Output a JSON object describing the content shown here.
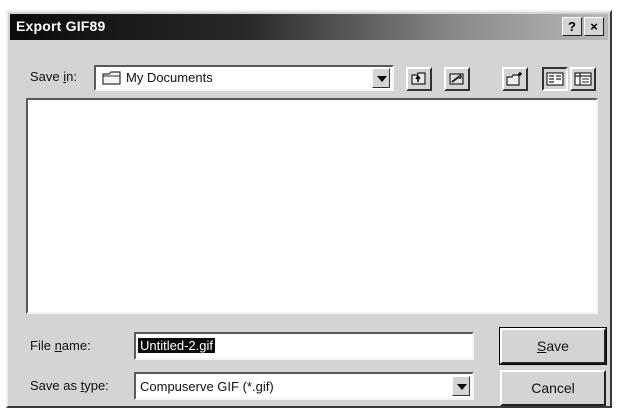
{
  "window": {
    "title": "Export GIF89",
    "help_label": "?",
    "close_label": "×"
  },
  "save_in": {
    "label_pre": "Save ",
    "label_u": "i",
    "label_post": "n:",
    "value": "My Documents"
  },
  "toolbar": {
    "icons": [
      "up-one-level-icon",
      "desktop-icon",
      "new-folder-icon",
      "list-view-icon",
      "details-view-icon"
    ]
  },
  "file_name": {
    "label_pre": "File ",
    "label_u": "n",
    "label_post": "ame:",
    "value": "Untitled-2.gif"
  },
  "save_as_type": {
    "label_pre": "Save as ",
    "label_u": "t",
    "label_post": "ype:",
    "value": "Compuserve GIF (*.gif)"
  },
  "buttons": {
    "save_u": "S",
    "save_rest": "ave",
    "cancel": "Cancel"
  }
}
